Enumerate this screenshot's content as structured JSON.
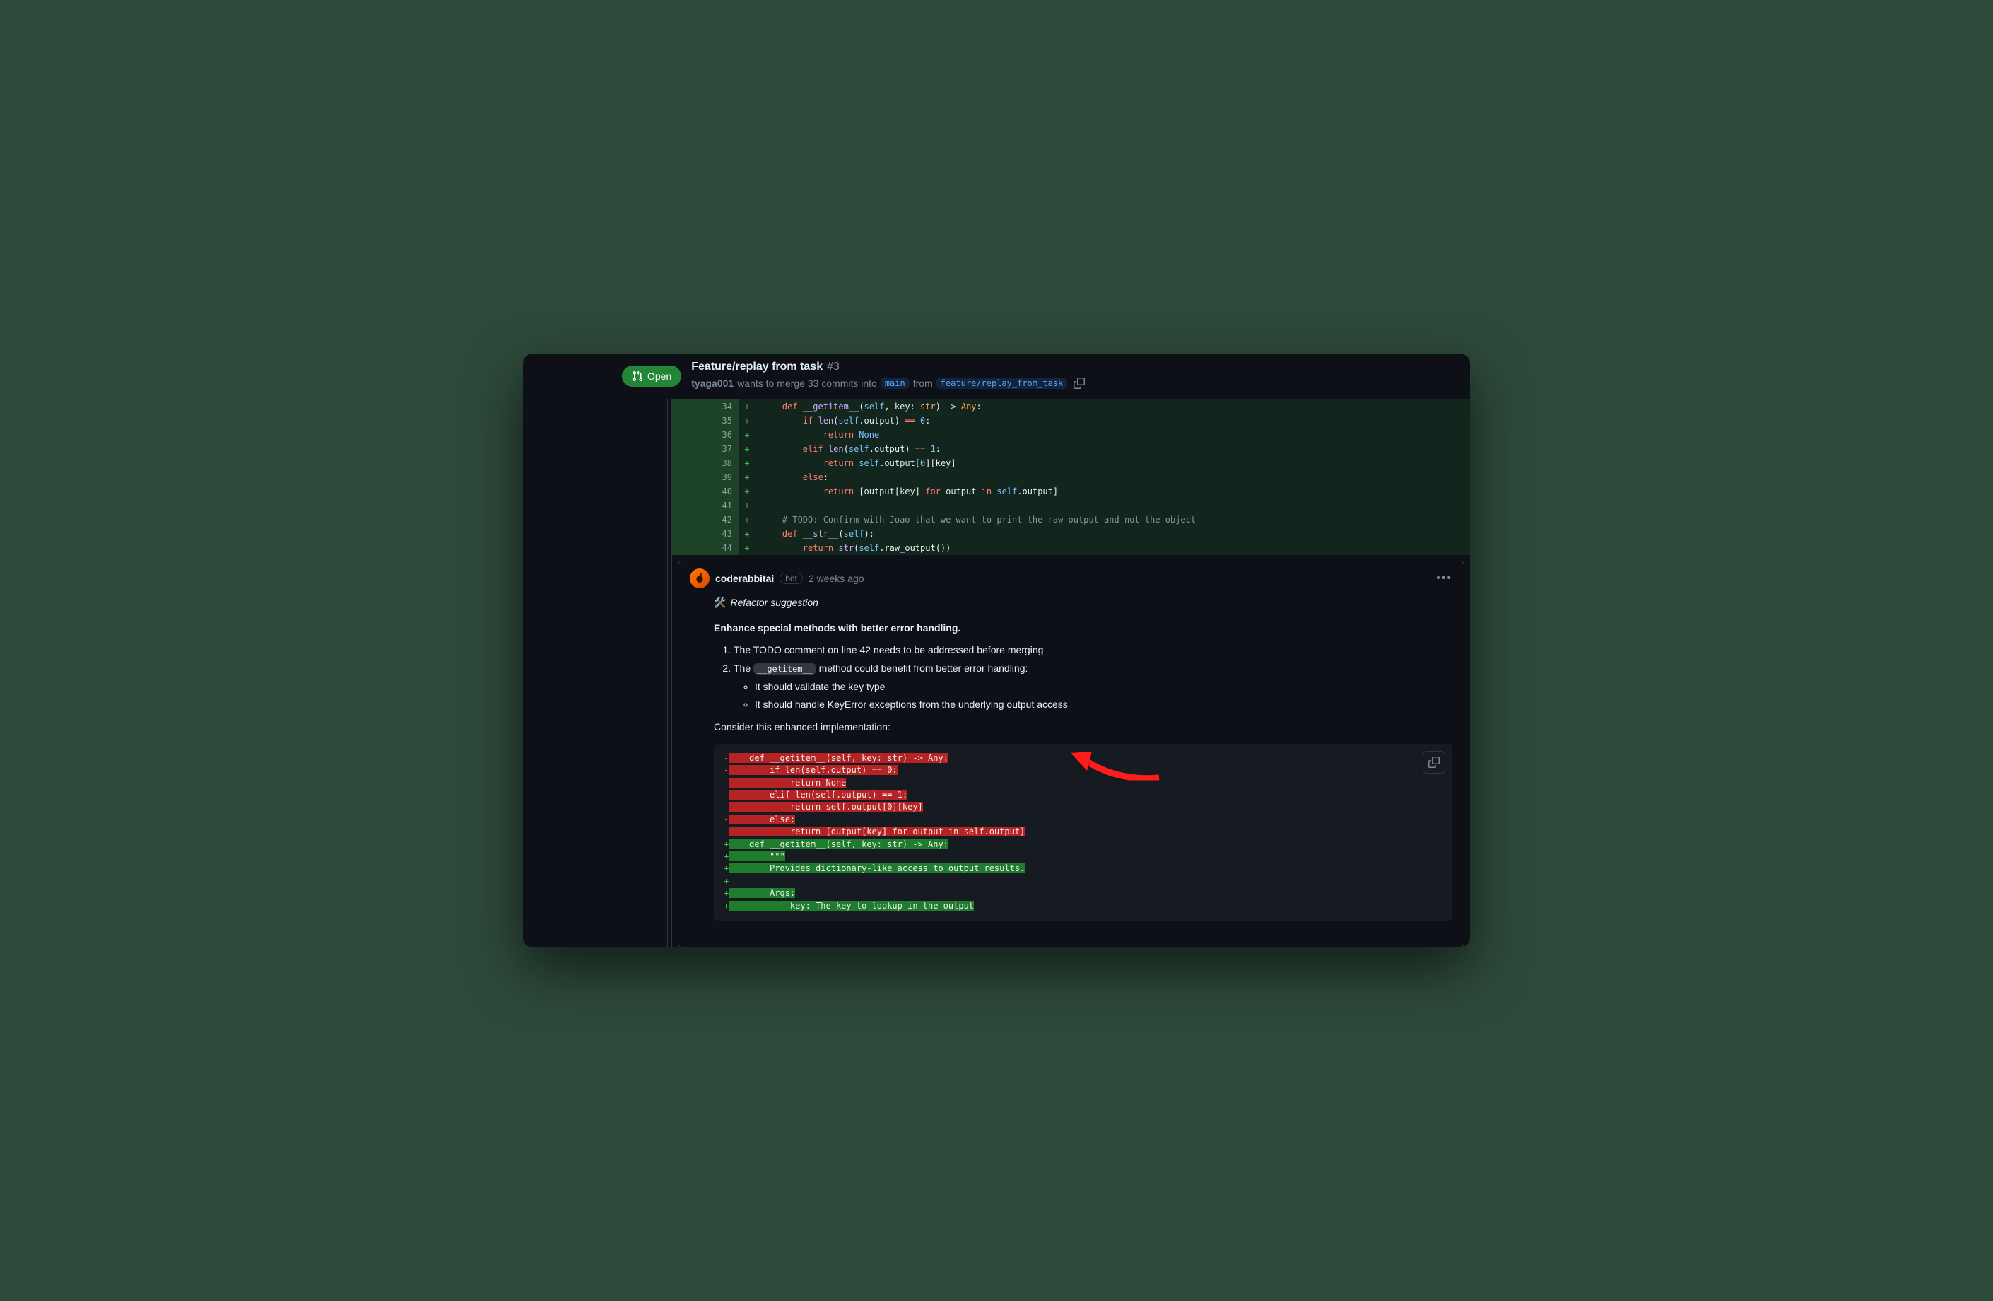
{
  "pr": {
    "status": "Open",
    "title": "Feature/replay from task",
    "number": "#3",
    "author": "tyaga001",
    "sub_prefix": "wants to merge 33 commits into",
    "base_branch": "main",
    "sub_middle": "from",
    "head_branch": "feature/replay_from_task"
  },
  "diff": [
    {
      "n": "34",
      "html": "    <span class='tk-kw'>def</span> <span class='tk-fn'>__getitem__</span>(<span class='tk-self'>self</span>, key: <span class='tk-type'>str</span>) -> <span class='tk-type'>Any</span>:"
    },
    {
      "n": "35",
      "html": "        <span class='tk-kw'>if</span> <span class='tk-fn'>len</span>(<span class='tk-self'>self</span>.output) <span class='tk-kw'>==</span> <span class='tk-num'>0</span>:"
    },
    {
      "n": "36",
      "html": "            <span class='tk-kw'>return</span> <span class='tk-const'>None</span>"
    },
    {
      "n": "37",
      "html": "        <span class='tk-kw'>elif</span> <span class='tk-fn'>len</span>(<span class='tk-self'>self</span>.output) <span class='tk-kw'>==</span> <span class='tk-num'>1</span>:"
    },
    {
      "n": "38",
      "html": "            <span class='tk-kw'>return</span> <span class='tk-self'>self</span>.output[<span class='tk-num'>0</span>][key]"
    },
    {
      "n": "39",
      "html": "        <span class='tk-kw'>else</span>:"
    },
    {
      "n": "40",
      "html": "            <span class='tk-kw'>return</span> [output[key] <span class='tk-kw'>for</span> output <span class='tk-kw'>in</span> <span class='tk-self'>self</span>.output]"
    },
    {
      "n": "41",
      "html": ""
    },
    {
      "n": "42",
      "html": "    <span class='tk-comment'># TODO: Confirm with Joao that we want to print the raw output and not the object</span>"
    },
    {
      "n": "43",
      "html": "    <span class='tk-kw'>def</span> <span class='tk-fn'>__str__</span>(<span class='tk-self'>self</span>):"
    },
    {
      "n": "44",
      "html": "        <span class='tk-kw'>return</span> <span class='tk-fn'>str</span>(<span class='tk-self'>self</span>.raw_output())"
    }
  ],
  "comment": {
    "author": "coderabbitai",
    "bot_label": "bot",
    "timestamp": "2 weeks ago",
    "kind_emoji": "🛠️",
    "kind": "Refactor suggestion",
    "heading": "Enhance special methods with better error handling.",
    "item1": "The TODO comment on line 42 needs to be addressed before merging",
    "item2_pre": "The ",
    "item2_code": "__getitem__",
    "item2_post": " method could benefit from better error handling:",
    "sub1": "It should validate the key type",
    "sub2": "It should handle KeyError exceptions from the underlying output access",
    "consider": "Consider this enhanced implementation:"
  },
  "suggestion": [
    {
      "t": "del",
      "text": "    def __getitem__(self, key: str) -> Any:"
    },
    {
      "t": "del",
      "text": "        if len(self.output) == 0:"
    },
    {
      "t": "del",
      "text": "            return None"
    },
    {
      "t": "del",
      "text": "        elif len(self.output) == 1:"
    },
    {
      "t": "del",
      "text": "            return self.output[0][key]"
    },
    {
      "t": "del",
      "text": "        else:"
    },
    {
      "t": "del",
      "text": "            return [output[key] for output in self.output]"
    },
    {
      "t": "add",
      "text": "    def __getitem__(self, key: str) -> Any:"
    },
    {
      "t": "add",
      "text": "        \"\"\""
    },
    {
      "t": "add",
      "text": "        Provides dictionary-like access to output results."
    },
    {
      "t": "add",
      "text": ""
    },
    {
      "t": "add",
      "text": "        Args:"
    },
    {
      "t": "add",
      "text": "            key: The key to lookup in the output"
    }
  ]
}
